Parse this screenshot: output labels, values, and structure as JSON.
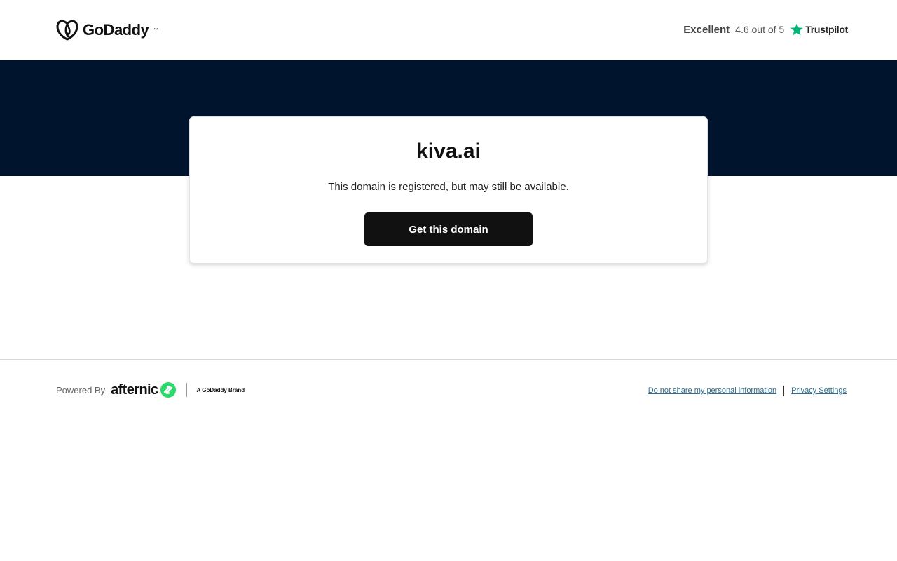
{
  "header": {
    "logo_text": "GoDaddy",
    "rating": {
      "word": "Excellent",
      "score": "4.6 out of 5",
      "provider": "Trustpilot",
      "star_color": "#00b67a"
    }
  },
  "hero": {
    "band_color": "#00142e"
  },
  "card": {
    "domain": "kiva.ai",
    "message": "This domain is registered, but may still be available.",
    "cta_label": "Get this domain"
  },
  "footer": {
    "powered_by": "Powered By",
    "afternic_text": "afternic",
    "brand_tag": "A GoDaddy Brand",
    "links": {
      "do_not_share": "Do not share my personal information",
      "privacy": "Privacy Settings"
    },
    "afternic_color": "#2bd96a",
    "link_color": "#2c6e8f"
  },
  "icons": {
    "logo": "godaddy-logo-icon",
    "trustpilot_star": "star-icon",
    "afternic_mark": "afternic-logo-icon"
  }
}
